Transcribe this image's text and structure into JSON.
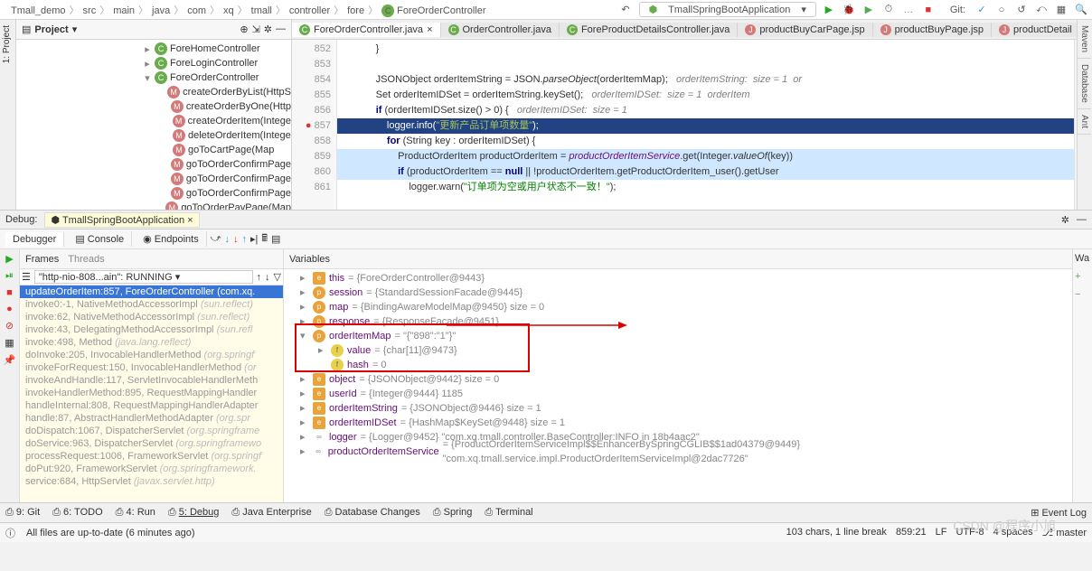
{
  "breadcrumb": [
    "Tmall_demo",
    "src",
    "main",
    "java",
    "com",
    "xq",
    "tmall",
    "controller",
    "fore",
    "ForeOrderController"
  ],
  "runConfig": "TmallSpringBootApplication",
  "gitLabel": "Git:",
  "projectLabel": "Project",
  "tree": [
    {
      "l": 1,
      "t": "c",
      "arrow": "▸",
      "lbl": "ForeHomeController"
    },
    {
      "l": 1,
      "t": "c",
      "arrow": "▸",
      "lbl": "ForeLoginController"
    },
    {
      "l": 1,
      "t": "c",
      "arrow": "▾",
      "lbl": "ForeOrderController"
    },
    {
      "l": 2,
      "t": "m",
      "lbl": "createOrderByList(HttpS"
    },
    {
      "l": 2,
      "t": "m",
      "lbl": "createOrderByOne(Http"
    },
    {
      "l": 2,
      "t": "m",
      "lbl": "createOrderItem(Intege"
    },
    {
      "l": 2,
      "t": "m",
      "lbl": "deleteOrderItem(Intege"
    },
    {
      "l": 2,
      "t": "m",
      "lbl": "goToCartPage(Map<Str"
    },
    {
      "l": 2,
      "t": "m",
      "lbl": "goToOrderConfirmPage"
    },
    {
      "l": 2,
      "t": "m",
      "lbl": "goToOrderConfirmPage"
    },
    {
      "l": 2,
      "t": "m",
      "lbl": "goToOrderConfirmPage"
    },
    {
      "l": 2,
      "t": "m",
      "lbl": "goToOrderPayPage(Map"
    }
  ],
  "editorTabs": [
    {
      "label": "ForeOrderController.java",
      "active": true,
      "cls": "c"
    },
    {
      "label": "OrderController.java",
      "cls": "c"
    },
    {
      "label": "ForeProductDetailsController.java",
      "cls": "c"
    },
    {
      "label": "productBuyCarPage.jsp",
      "cls": "j"
    },
    {
      "label": "productBuyPage.jsp",
      "cls": "j"
    },
    {
      "label": "productDetail",
      "cls": "j"
    }
  ],
  "lineNumbers": [
    "852",
    "853",
    "854",
    "855",
    "856",
    "857",
    "858",
    "859",
    "860",
    "861"
  ],
  "codeLines": [
    "            }",
    "",
    "            JSONObject orderItemString = JSON.<i class='mth'>parseObject</i>(orderItemMap);   <span class='cmt'>orderItemString:  size = 1  or</span>",
    "            Set<String> orderItemIDSet = orderItemString.keySet();   <span class='cmt'>orderItemIDSet:  size = 1  orderItem</span>",
    "            <span class='kw'>if</span> (orderItemIDSet.size() > 0) {   <span class='cmt'>orderItemIDSet:  size = 1</span>",
    "                logger.info(<span class='str'>\"更新产品订单项数量\"</span>);",
    "                <span class='kw'>for</span> (String key : orderItemIDSet) {",
    "                    ProductOrderItem productOrderItem = <span class='purple'>productOrderItemService</span>.get(Integer.<i class='mth'>valueOf</i>(key))",
    "                    <span class='kw'>if</span> (productOrderItem == <span class='kw'>null</span> || !productOrderItem.getProductOrderItem_user().getUser",
    "                        logger.warn(<span class='str'>\"订单项为空或用户状态不一致！\"</span>);"
  ],
  "debugLabel": "Debug:",
  "debugApp": "TmallSpringBootApplication",
  "debugTabs": [
    "Debugger",
    "Console",
    "Endpoints"
  ],
  "framesLabel": "Frames",
  "threadsLabel": "Threads",
  "threadSelect": "\"http-nio-808...ain\": RUNNING",
  "frames": [
    {
      "txt": "updateOrderItem:857, ForeOrderController (com.xq.",
      "sel": true
    },
    {
      "txt": "invoke0:-1, NativeMethodAccessorImpl <i>(sun.reflect)</i>"
    },
    {
      "txt": "invoke:62, NativeMethodAccessorImpl <i>(sun.reflect)</i>"
    },
    {
      "txt": "invoke:43, DelegatingMethodAccessorImpl <i>(sun.refl</i>"
    },
    {
      "txt": "invoke:498, Method <i>(java.lang.reflect)</i>"
    },
    {
      "txt": "doInvoke:205, InvocableHandlerMethod <i>(org.springf</i>"
    },
    {
      "txt": "invokeForRequest:150, InvocableHandlerMethod <i>(or</i>"
    },
    {
      "txt": "invokeAndHandle:117, ServletInvocableHandlerMeth"
    },
    {
      "txt": "invokeHandlerMethod:895, RequestMappingHandler"
    },
    {
      "txt": "handleInternal:808, RequestMappingHandlerAdapter"
    },
    {
      "txt": "handle:87, AbstractHandlerMethodAdapter <i>(org.spr</i>"
    },
    {
      "txt": "doDispatch:1067, DispatcherServlet <i>(org.springframe</i>"
    },
    {
      "txt": "doService:963, DispatcherServlet <i>(org.springframewo</i>"
    },
    {
      "txt": "processRequest:1006, FrameworkServlet <i>(org.springf</i>"
    },
    {
      "txt": "doPut:920, FrameworkServlet <i>(org.springframework.</i>"
    },
    {
      "txt": "service:684, HttpServlet <i>(javax.servlet.http)</i>"
    }
  ],
  "varsLabel": "Variables",
  "watchLabel": "Wa",
  "vars": [
    {
      "tri": "▸",
      "ico": "e",
      "name": "this",
      "val": " = {ForeOrderController@9443}"
    },
    {
      "tri": "▸",
      "ico": "p",
      "name": "session",
      "val": " = {StandardSessionFacade@9445}"
    },
    {
      "tri": "▸",
      "ico": "p",
      "name": "map",
      "val": " = {BindingAwareModelMap@9450} size = 0"
    },
    {
      "tri": "▸",
      "ico": "p",
      "name": "response",
      "val": " = {ResponseFacade@9451}"
    },
    {
      "tri": "▾",
      "ico": "p",
      "name": "orderItemMap",
      "val": " = \"{\"898\":\"1\"}\""
    },
    {
      "tri": "▸",
      "ico": "f",
      "name": "value",
      "val": " = {char[11]@9473}",
      "l": 2
    },
    {
      "tri": " ",
      "ico": "f",
      "name": "hash",
      "val": " = 0",
      "l": 2
    },
    {
      "tri": "▸",
      "ico": "e",
      "name": "object",
      "val": " = {JSONObject@9442} size = 0"
    },
    {
      "tri": "▸",
      "ico": "e",
      "name": "userId",
      "val": " = {Integer@9444} 1185"
    },
    {
      "tri": "▸",
      "ico": "e",
      "name": "orderItemString",
      "val": " = {JSONObject@9446} size = 1"
    },
    {
      "tri": "▸",
      "ico": "e",
      "name": "orderItemIDSet",
      "val": " = {HashMap$KeySet@9448} size = 1"
    },
    {
      "tri": "▸",
      "ico": "o",
      "name": "logger",
      "val": " = {Logger@9452} \"com.xq.tmall.controller.BaseController:INFO in 18b4aac2\""
    },
    {
      "tri": "▸",
      "ico": "o",
      "name": "productOrderItemService",
      "val": " = {ProductOrderItemServiceImpl$$EnhancerBySpringCGLIB$$1ad04379@9449} \"com.xq.tmall.service.impl.ProductOrderItemServiceImpl@2dac7726\""
    }
  ],
  "bottomTabs": [
    "9: Git",
    "6: TODO",
    "4: Run",
    "5: Debug",
    "Java Enterprise",
    "Database Changes",
    "Spring",
    "Terminal"
  ],
  "eventLog": "Event Log",
  "statusMsg": "All files are up-to-date (6 minutes ago)",
  "statusRight": [
    "103 chars, 1 line break",
    "859:21",
    "LF",
    "UTF-8",
    "4 spaces",
    "⎇ master"
  ],
  "watermark": "CSDN @程序小旭"
}
